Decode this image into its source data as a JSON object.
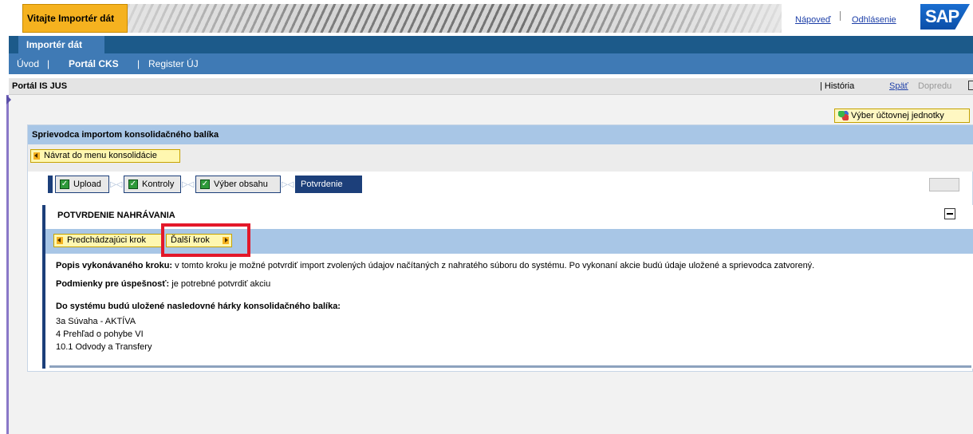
{
  "header": {
    "welcome": "Vitajte Importér dát",
    "help_link": "Nápoveď",
    "logout_link": "Odhlásenie",
    "logo": "SAP"
  },
  "nav": {
    "app_tab": "Importér dát",
    "items": [
      {
        "label": "Úvod"
      },
      {
        "label": "Portál CKS"
      },
      {
        "label": "Register ÚJ"
      }
    ],
    "separator": "|"
  },
  "titlebar": {
    "title": "Portál IS JUS",
    "history": "| História",
    "back": "Späť",
    "forward": "Dopredu"
  },
  "unit_button": "Výber účtovnej jednotky",
  "wizard": {
    "title": "Sprievodca importom konsolidačného balíka",
    "back_menu": "Návrat do menu konsolidácie",
    "steps": [
      {
        "label": "Upload",
        "done": true
      },
      {
        "label": "Kontroly",
        "done": true
      },
      {
        "label": "Výber obsahu",
        "done": true
      },
      {
        "label": "Potvrdenie",
        "done": false
      }
    ]
  },
  "panel": {
    "title": "POTVRDENIE NAHRÁVANIA",
    "prev_step": "Predchádzajúci krok",
    "next_step": "Ďalší krok",
    "desc_label": "Popis vykonávaného kroku:",
    "desc_text": " v tomto kroku je možné potvrdiť import zvolených údajov načítaných z nahratého súboru do systému. Po vykonaní akcie budú údaje uložené a sprievodca zatvorený.",
    "cond_label": "Podmienky pre úspešnosť:",
    "cond_text": " je potrebné potvrdiť akciu",
    "sheets_heading": "Do systému budú uložené nasledovné hárky konsolidačného balíka:",
    "sheets": [
      "3a Súvaha - AKTÍVA",
      "4 Prehľad o pohybe VI",
      "10.1 Odvody a Transfery"
    ]
  },
  "colors": {
    "nav_dark": "#1c5a8a",
    "nav_light": "#3f7ab5",
    "highlight": "#e3182a",
    "button_yellow": "#fff7b0"
  }
}
